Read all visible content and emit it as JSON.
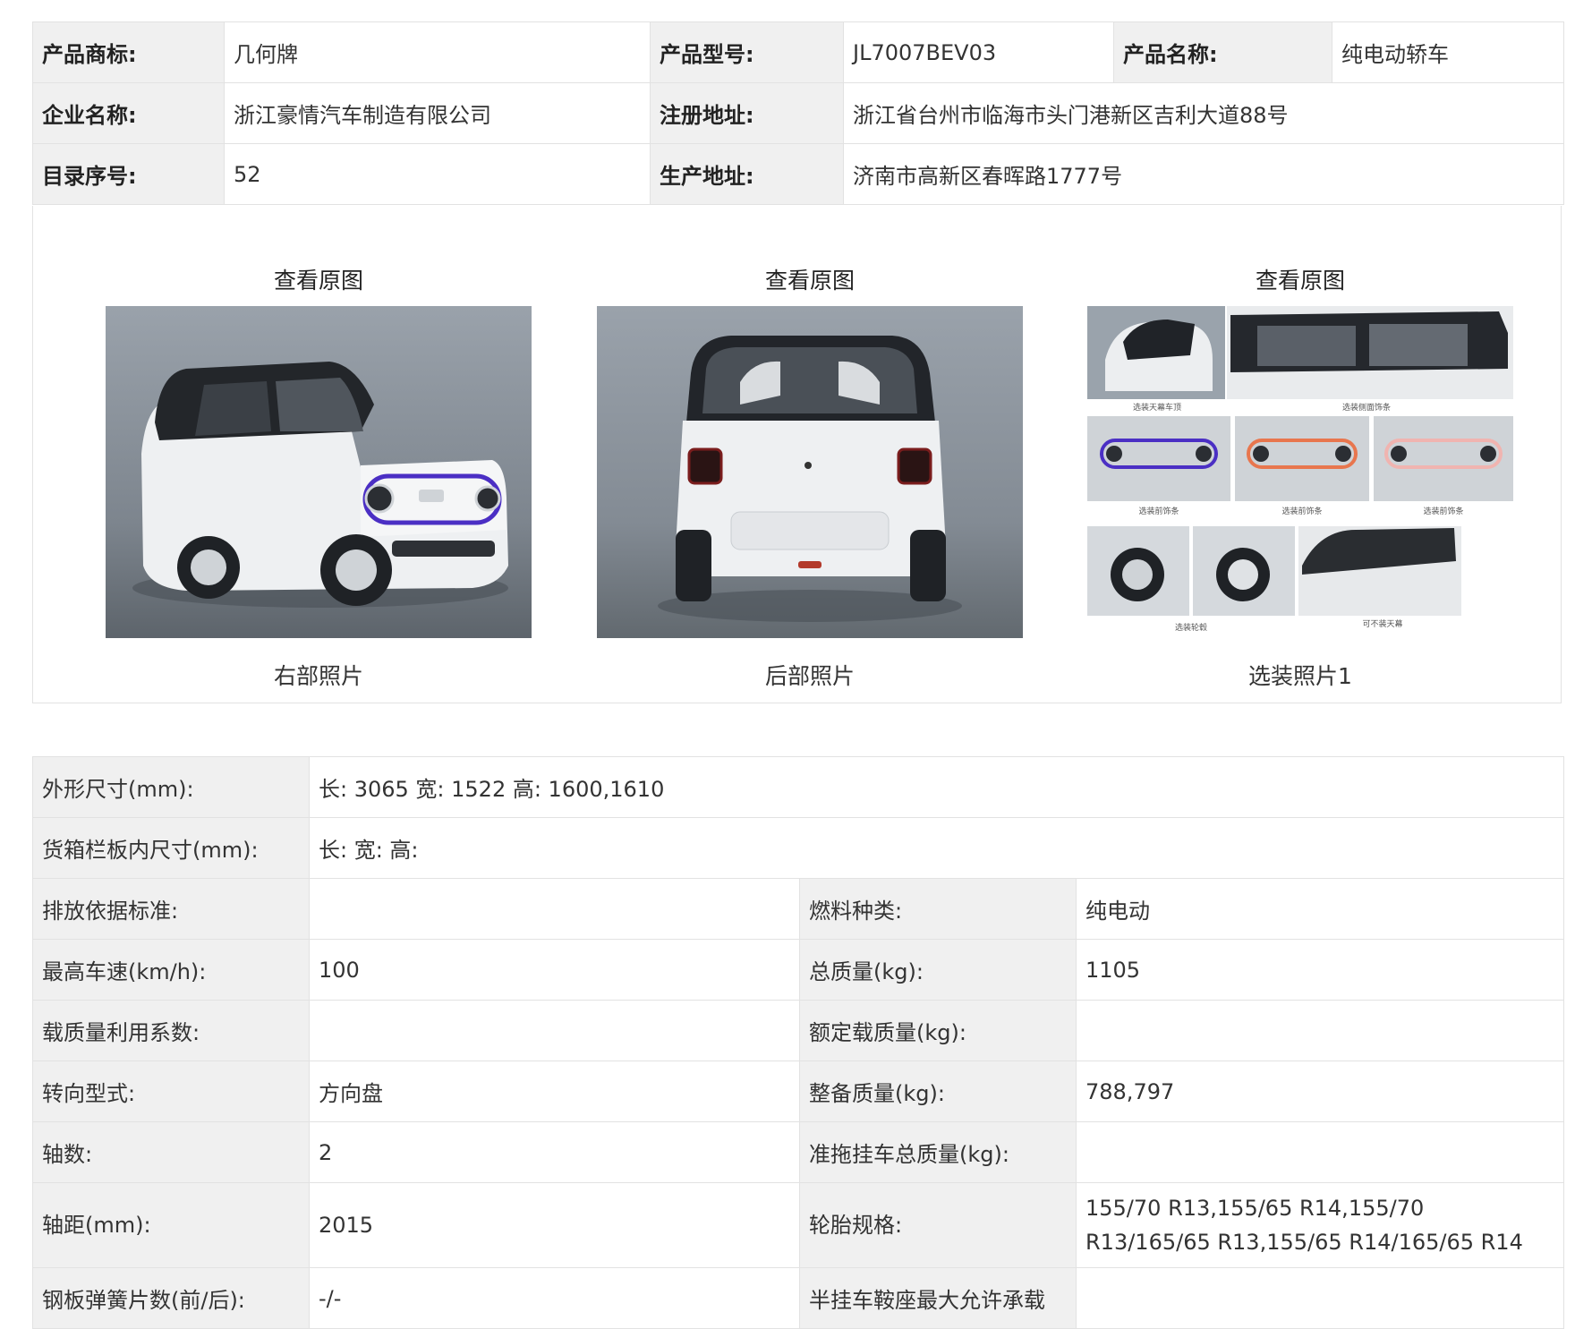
{
  "info": {
    "brand_label": "产品商标:",
    "brand_value": "几何牌",
    "model_label": "产品型号:",
    "model_value": "JL7007BEV03",
    "name_label": "产品名称:",
    "name_value": "纯电动轿车",
    "company_label": "企业名称:",
    "company_value": "浙江豪情汽车制造有限公司",
    "reg_addr_label": "注册地址:",
    "reg_addr_value": "浙江省台州市临海市头门港新区吉利大道88号",
    "catalog_label": "目录序号:",
    "catalog_value": "52",
    "prod_addr_label": "生产地址:",
    "prod_addr_value": "济南市高新区春晖路1777号"
  },
  "photos": [
    {
      "view_label": "查看原图",
      "caption": "右部照片"
    },
    {
      "view_label": "查看原图",
      "caption": "后部照片"
    },
    {
      "view_label": "查看原图",
      "caption": "选装照片1"
    }
  ],
  "photo3_labels": [
    "选装天幕车顶",
    "选装侧面饰条",
    "选装前饰条",
    "选装前饰条",
    "选装前饰条",
    "选装轮毂",
    "可不装天幕"
  ],
  "spec": {
    "dims_label": "外形尺寸(mm):",
    "dims_value": "长: 3065 宽: 1522 高: 1600,1610",
    "cargo_label": "货箱栏板内尺寸(mm):",
    "cargo_value": "长:  宽:  高:",
    "emission_label": "排放依据标准:",
    "emission_value": "",
    "fuel_label": "燃料种类:",
    "fuel_value": "纯电动",
    "speed_label": "最高车速(km/h):",
    "speed_value": "100",
    "total_mass_label": "总质量(kg):",
    "total_mass_value": "1105",
    "load_coef_label": "载质量利用系数:",
    "load_coef_value": "",
    "rated_load_label": "额定载质量(kg):",
    "rated_load_value": "",
    "steering_label": "转向型式:",
    "steering_value": "方向盘",
    "curb_label": "整备质量(kg):",
    "curb_value": "788,797",
    "axles_label": "轴数:",
    "axles_value": "2",
    "tow_label": "准拖挂车总质量(kg):",
    "tow_value": "",
    "wheelbase_label": "轴距(mm):",
    "wheelbase_value": "2015",
    "tire_label": "轮胎规格:",
    "tire_value": "155/70 R13,155/65 R14,155/70 R13/165/65 R13,155/65 R14/165/65 R14",
    "spring_label": "钢板弹簧片数(前/后):",
    "spring_value": "-/-",
    "saddle_label": "半挂车鞍座最大允许承载",
    "saddle_value": ""
  },
  "colors": {
    "label_bg": "#f0f0f0",
    "border": "#e2e2e2",
    "accent_purple": "#4b2fc4",
    "accent_orange": "#e8764e"
  }
}
